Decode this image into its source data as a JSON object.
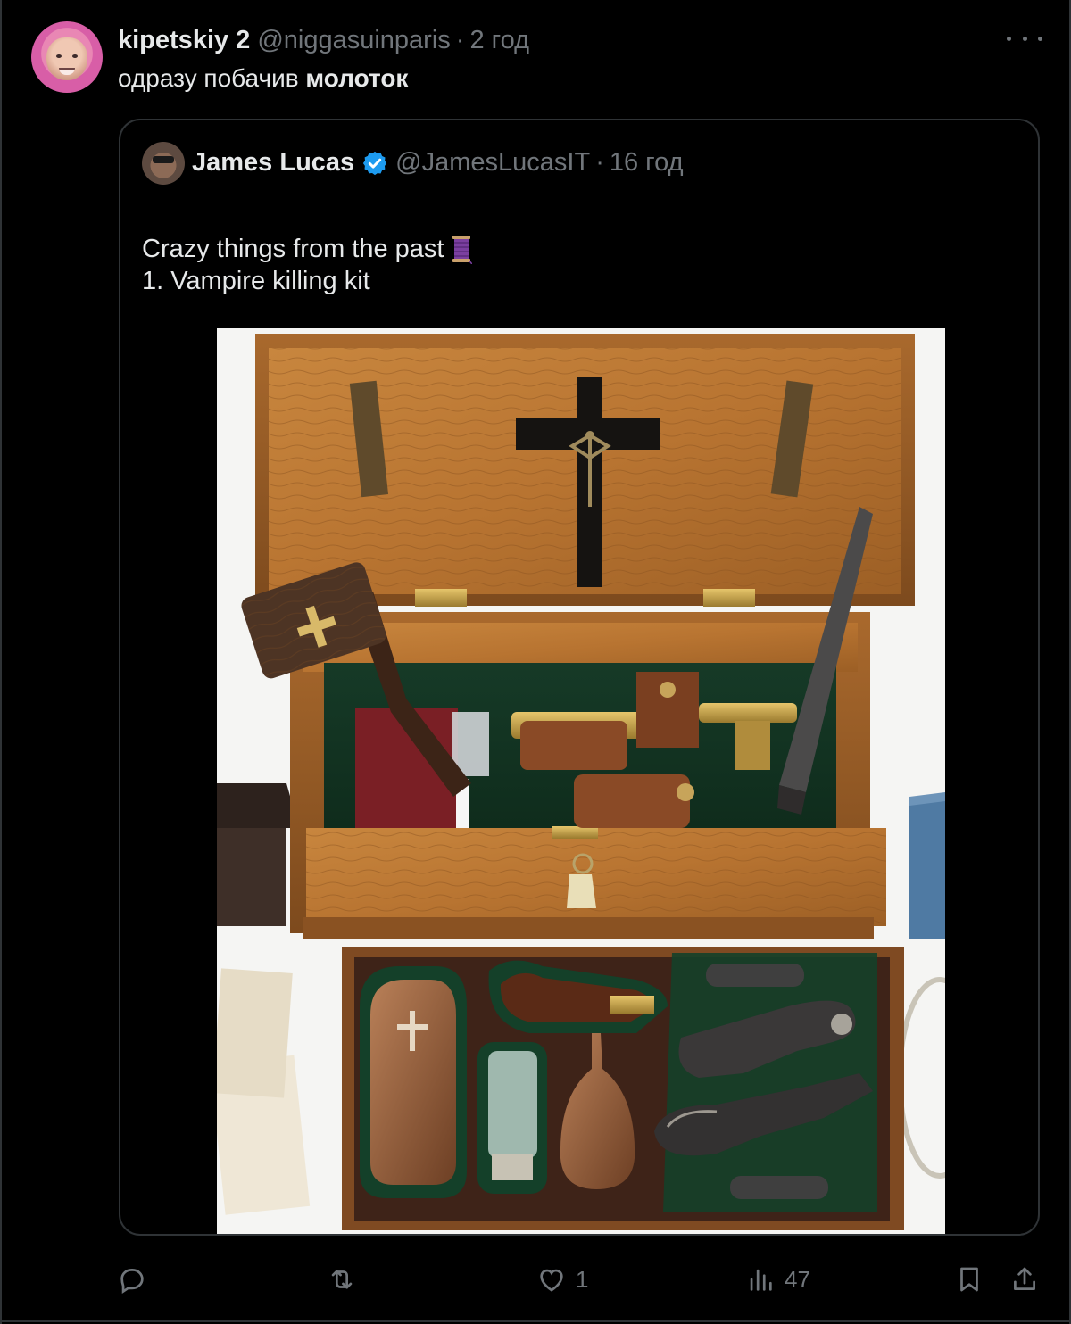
{
  "tweet": {
    "display_name": "kipetskiy 2",
    "handle": "@niggasuinparis",
    "separator": "·",
    "time": "2 год",
    "text_prefix": "одразу побачив ",
    "text_bold": "молоток"
  },
  "quoted_tweet": {
    "display_name": "James Lucas",
    "handle": "@JamesLucasIT",
    "separator": "·",
    "time": "16 год",
    "line1": "Crazy things from the past",
    "line2": "1. Vampire killing kit"
  },
  "actions": {
    "reply_count": "",
    "repost_count": "",
    "like_count": "1",
    "views_count": "47"
  },
  "colors": {
    "background": "#000000",
    "text": "#e7e9ea",
    "muted": "#71767b",
    "border": "#2f3336",
    "verified": "#1d9bf0"
  },
  "icons": [
    "more-icon",
    "verified-icon",
    "spool-emoji-icon",
    "reply-icon",
    "repost-icon",
    "like-icon",
    "views-icon",
    "bookmark-icon",
    "share-icon"
  ]
}
